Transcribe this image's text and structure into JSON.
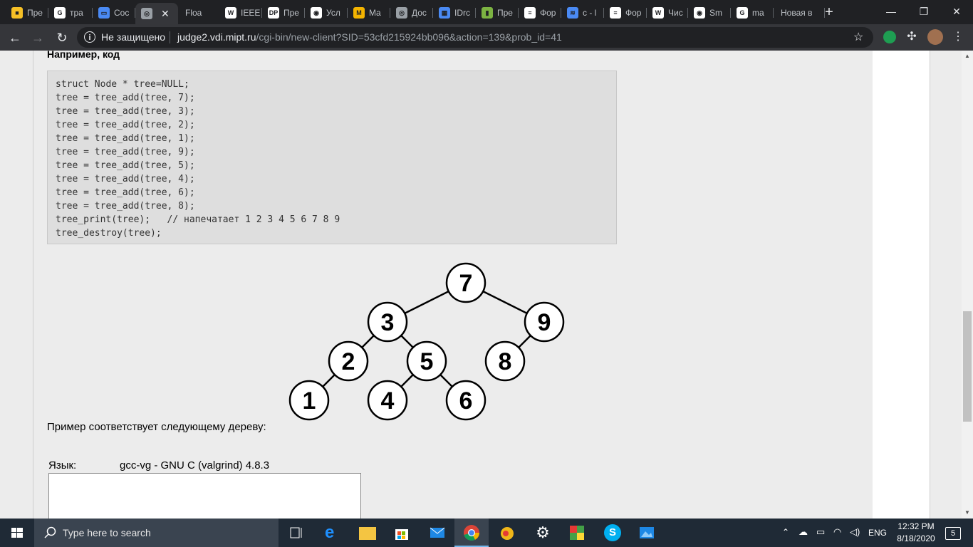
{
  "browser": {
    "tabs": [
      {
        "label": "Пре",
        "fav": "■",
        "color": "#f6c026"
      },
      {
        "label": "тра",
        "fav": "G",
        "color": "#ffffff"
      },
      {
        "label": "Сос",
        "fav": "▭",
        "color": "#4a8af4"
      },
      {
        "label": "",
        "fav": "◎",
        "color": "#9aa0a6"
      },
      {
        "label": "Floa",
        "fav": "",
        "color": "#202124"
      },
      {
        "label": "IEEE",
        "fav": "W",
        "color": "#ffffff"
      },
      {
        "label": "Пре",
        "fav": "DP",
        "color": "#ffffff"
      },
      {
        "label": "Усл",
        "fav": "◉",
        "color": "#ffffff"
      },
      {
        "label": "Ma",
        "fav": "M",
        "color": "#f4b400"
      },
      {
        "label": "Дос",
        "fav": "◎",
        "color": "#9aa0a6"
      },
      {
        "label": "IDrc",
        "fav": "▦",
        "color": "#4a8af4"
      },
      {
        "label": "Пре",
        "fav": "▮",
        "color": "#7cb342"
      },
      {
        "label": "Фор",
        "fav": "≡",
        "color": "#ffffff"
      },
      {
        "label": "c - l",
        "fav": "≋",
        "color": "#4a8af4"
      },
      {
        "label": "Фор",
        "fav": "≡",
        "color": "#ffffff"
      },
      {
        "label": "Чис",
        "fav": "W",
        "color": "#ffffff"
      },
      {
        "label": "Sm",
        "fav": "◉",
        "color": "#ffffff"
      },
      {
        "label": "ma",
        "fav": "G",
        "color": "#ffffff"
      },
      {
        "label": "Новая в",
        "fav": "",
        "color": "#202124"
      }
    ],
    "new_tab": "+",
    "win_min": "—",
    "win_max": "❐",
    "win_close": "✕",
    "back": "←",
    "forward": "→",
    "reload": "↻",
    "secure_label": "Не защищено",
    "url_host": "judge2.vdi.mipt.ru",
    "url_path": "/cgi-bin/new-client?SID=53cfd215924bb096&action=139&prob_id=41",
    "star": "☆"
  },
  "page": {
    "heading": "Например, код",
    "code_lines": [
      "struct Node * tree=NULL;",
      "tree = tree_add(tree, 7);",
      "tree = tree_add(tree, 3);",
      "tree = tree_add(tree, 2);",
      "tree = tree_add(tree, 1);",
      "tree = tree_add(tree, 9);",
      "tree = tree_add(tree, 5);",
      "tree = tree_add(tree, 4);",
      "tree = tree_add(tree, 6);",
      "tree = tree_add(tree, 8);",
      "tree_print(tree);   // напечатает 1 2 3 4 5 6 7 8 9",
      "tree_destroy(tree);"
    ],
    "tree_nodes": [
      "7",
      "3",
      "9",
      "2",
      "5",
      "8",
      "1",
      "4",
      "6"
    ],
    "caption": "Пример соответствует следующему дереву:",
    "lang_label": "Язык:",
    "lang_value": "gcc-vg - GNU C (valgrind) 4.8.3"
  },
  "taskbar": {
    "search_placeholder": "Type here to search",
    "lang": "ENG",
    "time": "12:32 PM",
    "date": "8/18/2020",
    "notifications": "5"
  }
}
